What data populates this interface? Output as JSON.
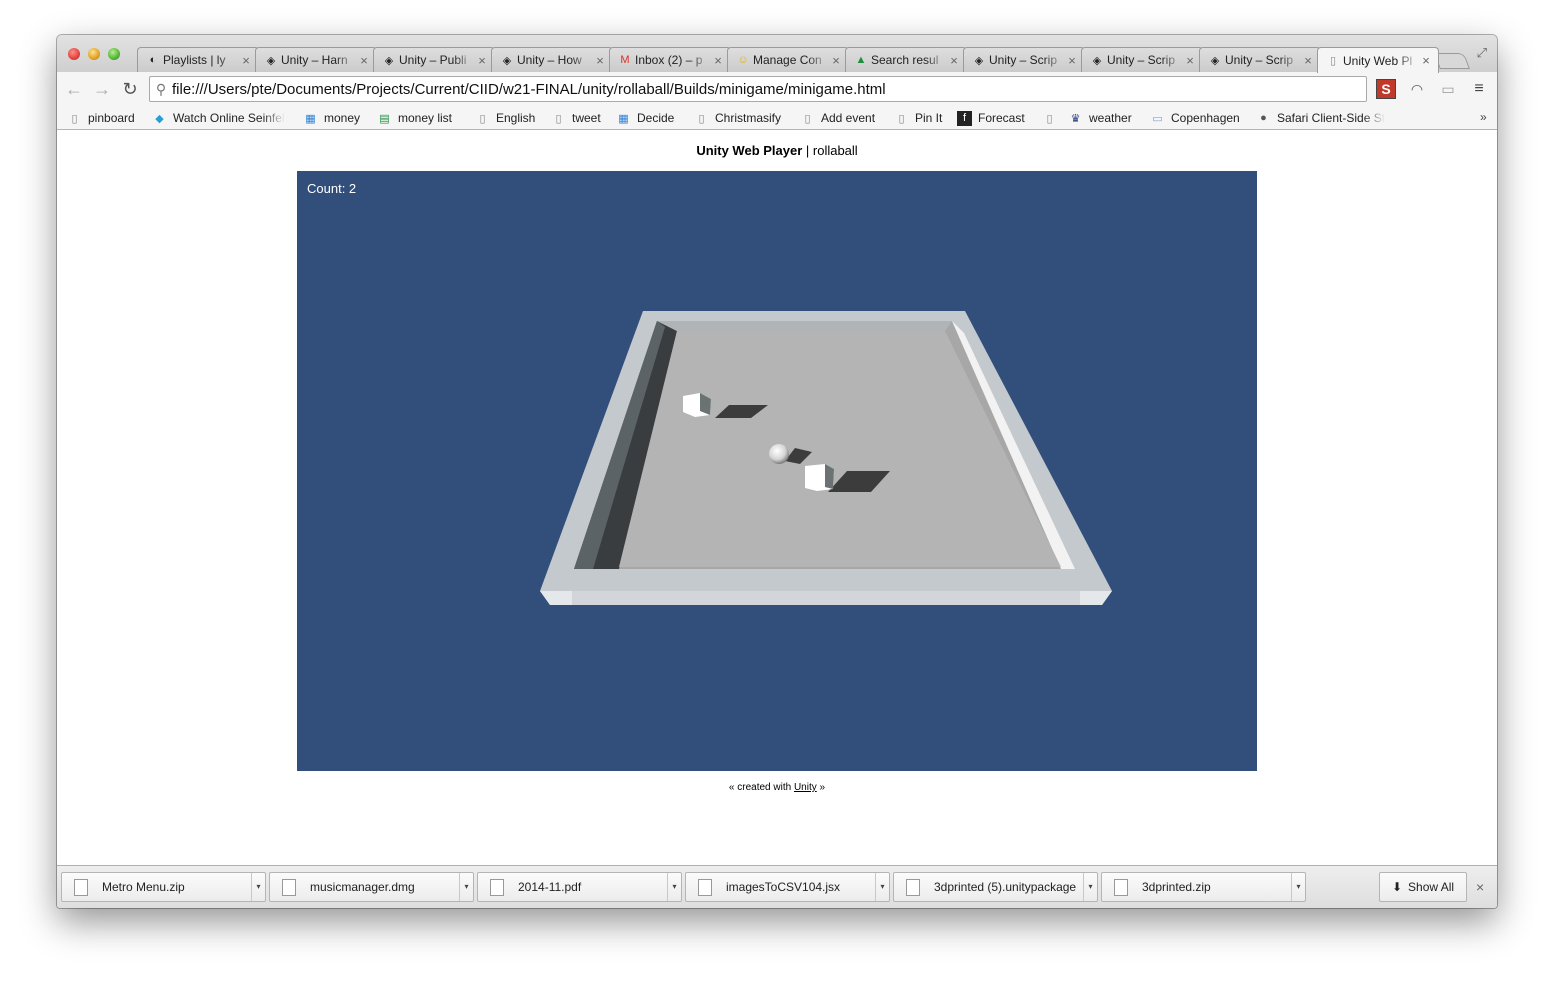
{
  "window": {
    "close": "close",
    "minimize": "minimize",
    "zoom": "zoom"
  },
  "tabs": [
    {
      "title": "Playlists | ly",
      "icon": "soundcloud-icon"
    },
    {
      "title": "Unity – Harn",
      "icon": "unity-icon"
    },
    {
      "title": "Unity – Publi",
      "icon": "unity-icon"
    },
    {
      "title": "Unity – How",
      "icon": "unity-icon"
    },
    {
      "title": "Inbox (2) – p",
      "icon": "gmail-icon"
    },
    {
      "title": "Manage Con",
      "icon": "smiley-icon"
    },
    {
      "title": "Search resul",
      "icon": "drive-icon"
    },
    {
      "title": "Unity – Scrip",
      "icon": "unity-icon"
    },
    {
      "title": "Unity – Scrip",
      "icon": "unity-icon"
    },
    {
      "title": "Unity – Scrip",
      "icon": "unity-icon"
    },
    {
      "title": "Unity Web Pl",
      "icon": "page-icon",
      "active": true
    }
  ],
  "toolbar": {
    "url": "file:///Users/pte/Documents/Projects/Current/CIID/w21-FINAL/unity/rollaball/Builds/minigame/minigame.html"
  },
  "bookmarks": [
    {
      "label": "pinboard",
      "icon": "page-icon"
    },
    {
      "label": "Watch Online Seinfel",
      "icon": "cube-icon"
    },
    {
      "label": "money",
      "icon": "calc-icon"
    },
    {
      "label": "money list",
      "icon": "sheet-icon"
    },
    {
      "label": "English",
      "icon": "page-icon"
    },
    {
      "label": "tweet",
      "icon": "page-icon"
    },
    {
      "label": "Decide",
      "icon": "calc-icon"
    },
    {
      "label": "Christmasify",
      "icon": "page-icon"
    },
    {
      "label": "Add event",
      "icon": "page-icon"
    },
    {
      "label": "Pin It",
      "icon": "page-icon"
    },
    {
      "label": "Forecast",
      "icon": "forecast-icon"
    },
    {
      "label": "",
      "icon": "page-icon"
    },
    {
      "label": "weather",
      "icon": "crown-icon"
    },
    {
      "label": "Copenhagen",
      "icon": "folder-icon"
    },
    {
      "label": "Safari Client-Side St",
      "icon": "apple-icon"
    }
  ],
  "bookmarks_overflow": "»",
  "page": {
    "title_bold": "Unity Web Player",
    "title_rest": " | rollaball",
    "count_label": "Count: 2",
    "footer_before": "« created with ",
    "footer_link": "Unity",
    "footer_after": " »"
  },
  "colors": {
    "game_bg": "#324e7b",
    "floor": "#b4b4b4",
    "wall": "#c8cdd2"
  },
  "downloads": [
    {
      "name": "Metro Menu.zip"
    },
    {
      "name": "musicmanager.dmg"
    },
    {
      "name": "2014-11.pdf"
    },
    {
      "name": "imagesToCSV104.jsx"
    },
    {
      "name": "3dprinted (5).unitypackage"
    },
    {
      "name": "3dprinted.zip"
    }
  ],
  "downloads_show_all": "Show All"
}
